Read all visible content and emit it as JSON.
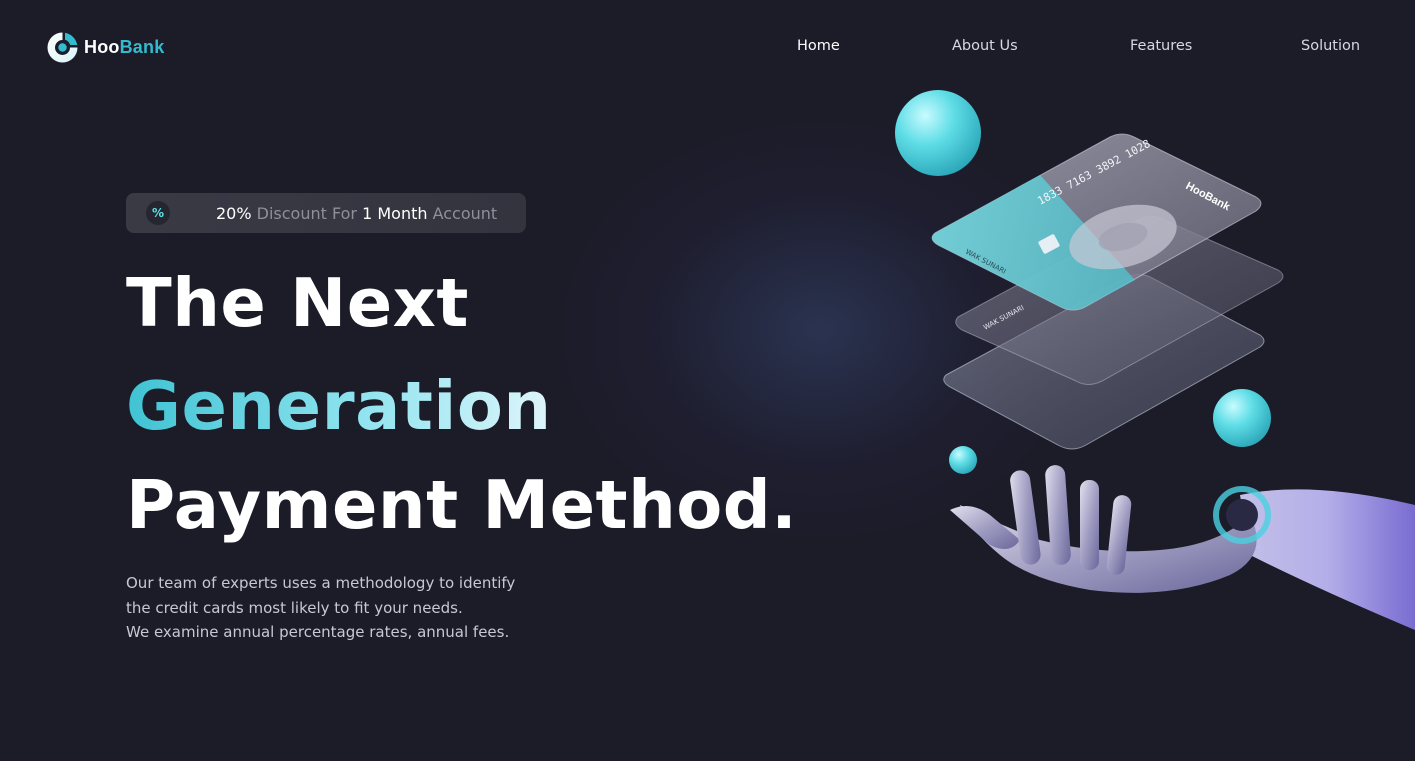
{
  "brand": {
    "name_part1": "Hoo",
    "name_part2": "Bank",
    "accent": "#33bbcf"
  },
  "nav": {
    "items": [
      {
        "label": "Home",
        "active": true
      },
      {
        "label": "About Us",
        "active": false
      },
      {
        "label": "Features",
        "active": false
      },
      {
        "label": "Solution",
        "active": false
      }
    ]
  },
  "badge": {
    "icon": "discount-icon",
    "value": "20%",
    "text1": "Discount For",
    "duration": "1 Month",
    "text2": "Account"
  },
  "hero": {
    "line1": "The Next",
    "line2": "Generation",
    "line3": "Payment Method.",
    "description": [
      "Our team of experts uses a methodology to identify",
      "the credit cards most likely to fit your needs.",
      "We examine annual percentage rates, annual fees."
    ]
  },
  "illustration": {
    "card_number": "1833 7163 3892 1028",
    "card_brand": "HooBank",
    "card_holder": "WAK SUNARI"
  },
  "colors": {
    "background": "#1c1b28",
    "accent": "#33bbcf",
    "gradient_text_start": "#3fc3d3",
    "gradient_text_end": "#dff6fb"
  }
}
